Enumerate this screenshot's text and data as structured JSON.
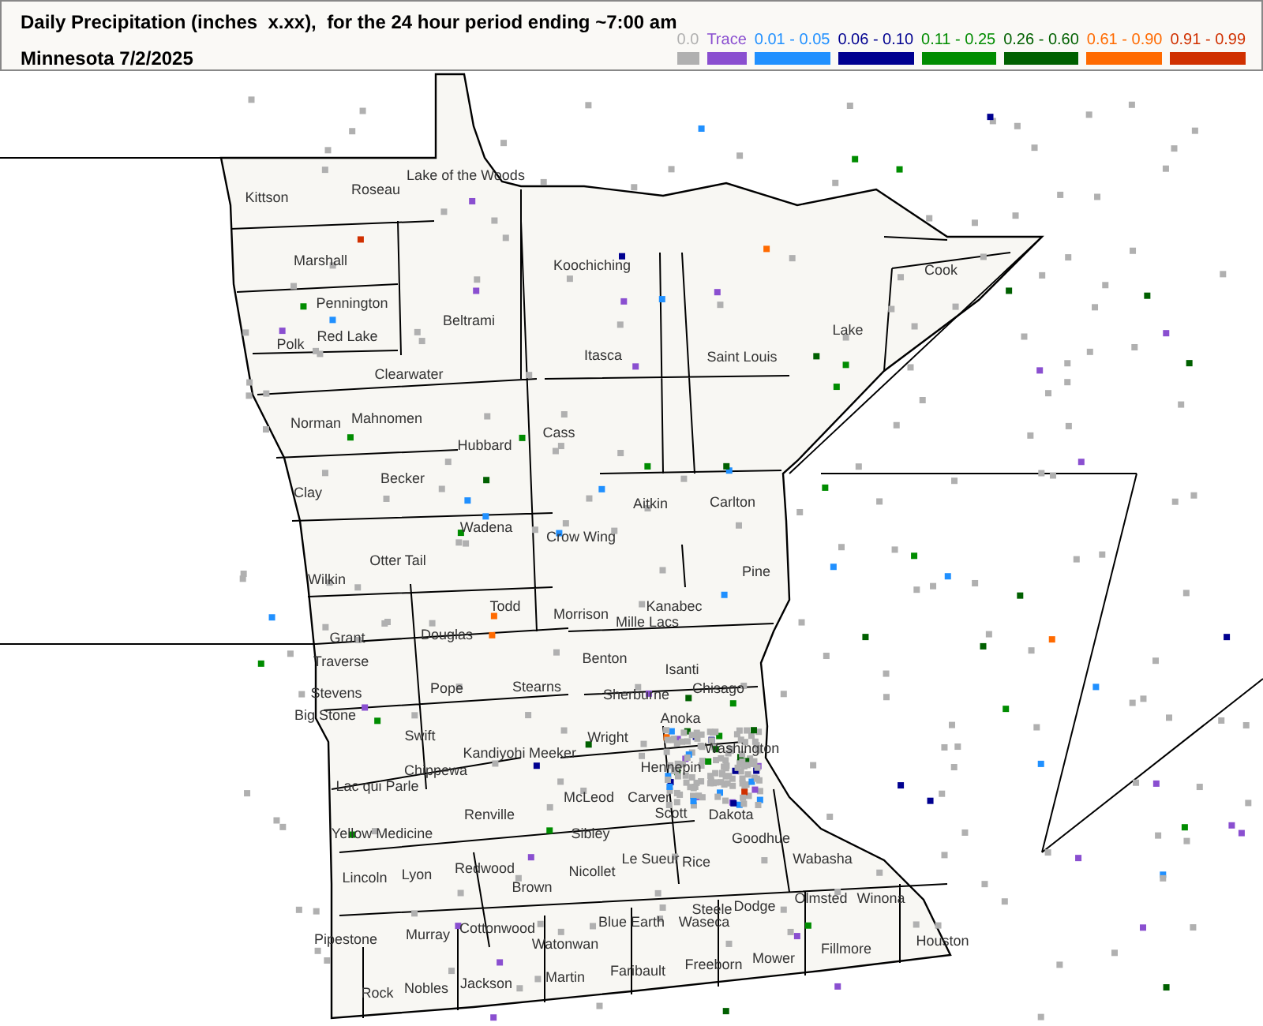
{
  "header": {
    "title": "Daily Precipitation (inches  x.xx),  for the 24 hour period ending ~7:00 am",
    "subtitle": "Minnesota 7/2/2025"
  },
  "legend": [
    {
      "label": "0.0",
      "color": "#b0b0b0"
    },
    {
      "label": "Trace",
      "color": "#8a4fd0"
    },
    {
      "label": "0.01 - 0.05",
      "color": "#2090ff"
    },
    {
      "label": "0.06 - 0.10",
      "color": "#000090"
    },
    {
      "label": "0.11 - 0.25",
      "color": "#008c00"
    },
    {
      "label": "0.26 - 0.60",
      "color": "#006000"
    },
    {
      "label": "0.61 - 0.90",
      "color": "#ff6a00"
    },
    {
      "label": "0.91 - 0.99",
      "color": "#d03000"
    }
  ],
  "map": {
    "counties": [
      "Kittson",
      "Roseau",
      "Lake of the Woods",
      "Marshall",
      "Koochiching",
      "Pennington",
      "Red Lake",
      "Polk",
      "Beltrami",
      "Itasca",
      "Saint Louis",
      "Lake",
      "Cook",
      "Clearwater",
      "Norman",
      "Mahnomen",
      "Cass",
      "Hubbard",
      "Becker",
      "Clay",
      "Aitkin",
      "Carlton",
      "Wadena",
      "Crow Wing",
      "Otter Tail",
      "Wilkin",
      "Pine",
      "Todd",
      "Morrison",
      "Kanabec",
      "Mille Lacs",
      "Grant",
      "Douglas",
      "Traverse",
      "Benton",
      "Isanti",
      "Stevens",
      "Pope",
      "Stearns",
      "Sherburne",
      "Chisago",
      "Big Stone",
      "Anoka",
      "Swift",
      "Kandiyohi",
      "Meeker",
      "Wright",
      "Washington",
      "Chippewa",
      "Hennepin",
      "Lac qui Parle",
      "McLeod",
      "Carver",
      "Renville",
      "Scott",
      "Dakota",
      "Yellow Medicine",
      "Sibley",
      "Goodhue",
      "Le Sueur",
      "Rice",
      "Wabasha",
      "Redwood",
      "Lincoln",
      "Lyon",
      "Nicollet",
      "Brown",
      "Olmsted",
      "Winona",
      "Steele",
      "Dodge",
      "Blue Earth",
      "Waseca",
      "Pipestone",
      "Murray",
      "Cottonwood",
      "Watonwan",
      "Houston",
      "Fillmore",
      "Mower",
      "Freeborn",
      "Faribault",
      "Martin",
      "Jackson",
      "Nobles",
      "Rock"
    ]
  }
}
